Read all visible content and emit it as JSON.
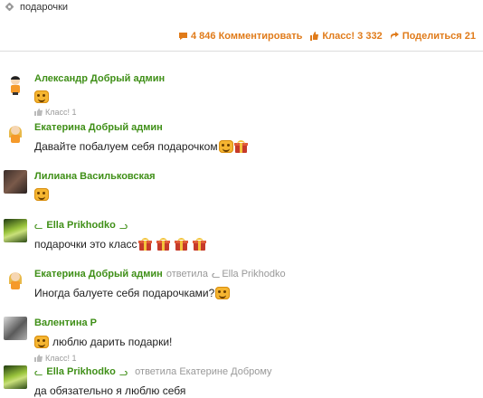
{
  "tag": {
    "label": "подарочки",
    "icon": "tag-icon"
  },
  "actions": {
    "comments": "4 846 Комментировать",
    "klass": "Класс! 3 332",
    "share": "Поделиться 21"
  },
  "comments": [
    {
      "author": "Александр Добрый админ",
      "avatar": "avatar-boy-icon",
      "text": "",
      "emojis": [
        "smiley"
      ],
      "likes": "Класс! 1"
    },
    {
      "author": "Екатерина Добрый админ",
      "avatar": "avatar-girl-icon",
      "text": "Давайте побалуем себя подарочком",
      "emojis": [
        "smiley",
        "gift"
      ]
    },
    {
      "author": "Лилиана Васильковская",
      "avatar": "avatar-photo",
      "text": "",
      "emojis": [
        "smiley"
      ]
    },
    {
      "author": "Ella Prikhodko",
      "avatar": "avatar-photo",
      "text": "подарочки это класс",
      "emojis": [
        "gift",
        "gift",
        "gift",
        "gift"
      ]
    },
    {
      "author": "Екатерина Добрый админ",
      "avatar": "avatar-girl-icon",
      "meta": "ответила",
      "reply_to": "Ella Prikhodko",
      "text": "Иногда балуете себя подарочками?",
      "emojis": [
        "smiley"
      ]
    },
    {
      "author": "Валентина Р",
      "avatar": "avatar-photo",
      "text": "люблю дарить подарки!",
      "emojis_before": [
        "smiley"
      ],
      "likes": "Класс! 1"
    },
    {
      "author": "Ella Prikhodko",
      "avatar": "avatar-photo",
      "meta": "ответила Екатерине Доброму",
      "text": "да обязательно я люблю себя"
    }
  ]
}
